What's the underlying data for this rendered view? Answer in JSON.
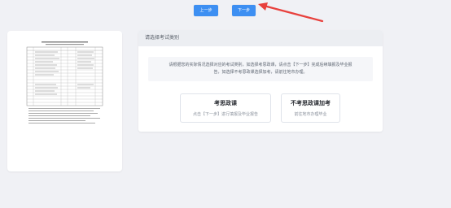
{
  "toolbar": {
    "prev_label": "上一步",
    "next_label": "下一步"
  },
  "annotation": {
    "arrow_color": "#e8413d"
  },
  "main": {
    "header_title": "请选择考试类别",
    "notice_line1": "请根据您的实际情况选择对应的考试类别，如选择考思政课，请点击【下一步】完成后续填报及毕业报",
    "notice_line2": "告，如选择不考思政课选择加考，请前往地市办理。",
    "options": [
      {
        "title": "考思政课",
        "desc": "点击【下一步】进行填报及毕业报告"
      },
      {
        "title": "不考思政课加考",
        "desc": "前往地市办理毕业"
      }
    ]
  },
  "colors": {
    "accent": "#3d8ff2",
    "page_bg": "#f0f1f5",
    "header_bg": "#eceef2"
  }
}
